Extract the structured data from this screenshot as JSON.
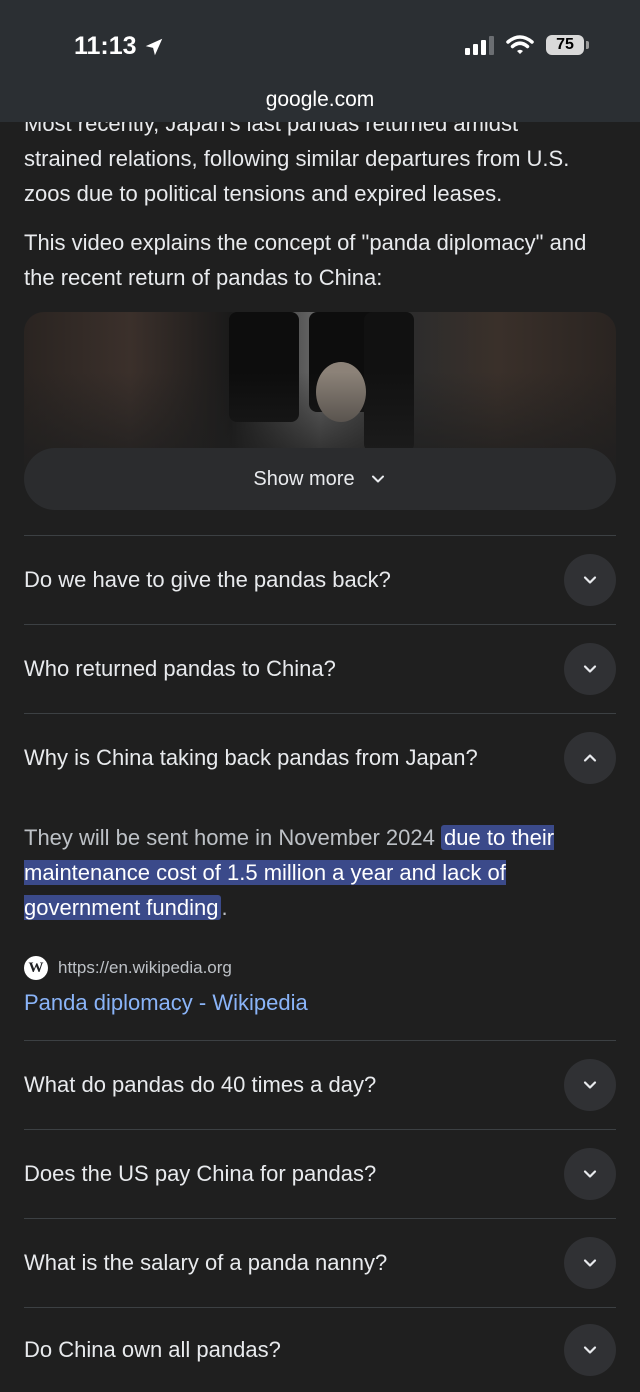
{
  "status_bar": {
    "time": "11:13",
    "battery": "75"
  },
  "browser": {
    "url": "google.com"
  },
  "article": {
    "partial_line": "Most recently, Japan's last pandas returned amidst",
    "paragraph_rest": "strained relations, following similar departures from U.S. zoos due to political tensions and expired leases.",
    "video_intro": "This video explains the concept of \"panda diplomacy\" and the recent return of pandas to China:"
  },
  "show_more": {
    "label": "Show more"
  },
  "faqs": [
    {
      "question": "Do we have to give the pandas back?",
      "expanded": false
    },
    {
      "question": "Who returned pandas to China?",
      "expanded": false
    },
    {
      "question": "Why is China taking back pandas from Japan?",
      "expanded": true
    },
    {
      "question": "What do pandas do 40 times a day?",
      "expanded": false
    },
    {
      "question": "Does the US pay China for pandas?",
      "expanded": false
    },
    {
      "question": "What is the salary of a panda nanny?",
      "expanded": false
    },
    {
      "question": "Do China own all pandas?",
      "expanded": false
    }
  ],
  "answer": {
    "plain_text": "They will be sent home in November 2024",
    "highlighted_text": "due to their maintenance cost of 1.5 million a year and lack of government funding",
    "trailing": ".",
    "source_url": "https://en.wikipedia.org",
    "source_title": "Panda diplomacy - Wikipedia",
    "source_icon_letter": "W"
  },
  "icons": {
    "location": "location-arrow-icon",
    "signal": "cellular-signal-icon",
    "wifi": "wifi-icon",
    "battery": "battery-icon",
    "chevron_down": "chevron-down-icon",
    "chevron_up": "chevron-up-icon",
    "wikipedia": "wikipedia-icon"
  },
  "colors": {
    "background": "#1f1f1f",
    "link": "#8ab4f8",
    "highlight": "#3b4a8a"
  }
}
